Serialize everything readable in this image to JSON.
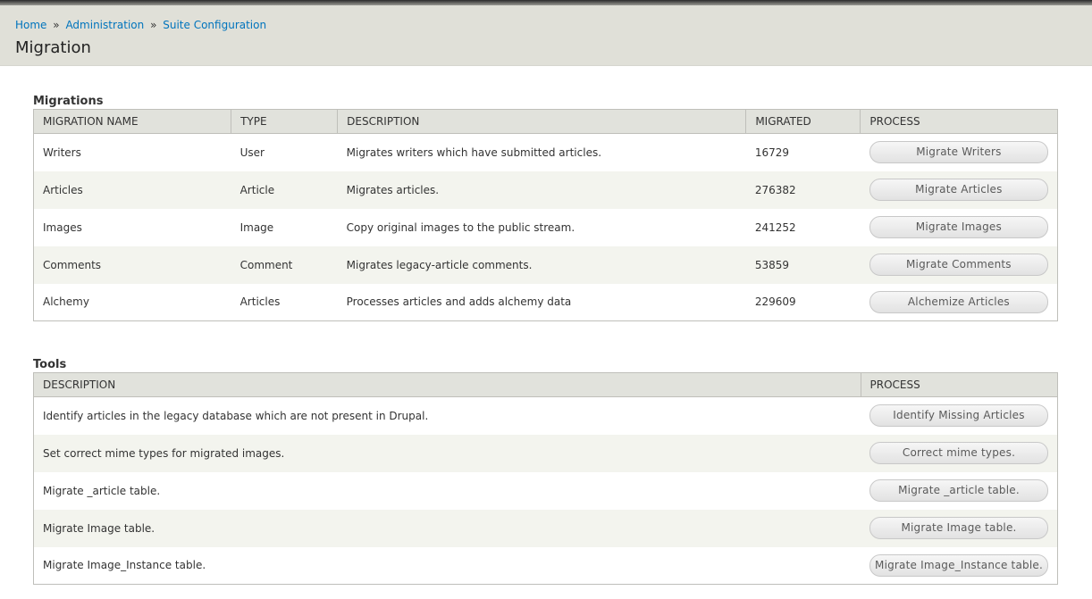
{
  "breadcrumb": {
    "items": [
      "Home",
      "Administration",
      "Suite Configuration"
    ],
    "separator": "»"
  },
  "page_title": "Migration",
  "migrations": {
    "title": "Migrations",
    "headers": [
      "MIGRATION NAME",
      "TYPE",
      "DESCRIPTION",
      "MIGRATED",
      "PROCESS"
    ],
    "rows": [
      {
        "name": "Writers",
        "type": "User",
        "description": "Migrates writers which have submitted articles.",
        "migrated": "16729",
        "button": "Migrate Writers"
      },
      {
        "name": "Articles",
        "type": "Article",
        "description": "Migrates articles.",
        "migrated": "276382",
        "button": "Migrate Articles"
      },
      {
        "name": "Images",
        "type": "Image",
        "description": "Copy original images to the public stream.",
        "migrated": "241252",
        "button": "Migrate Images"
      },
      {
        "name": "Comments",
        "type": "Comment",
        "description": "Migrates legacy-article comments.",
        "migrated": "53859",
        "button": "Migrate Comments"
      },
      {
        "name": "Alchemy",
        "type": "Articles",
        "description": "Processes articles and adds alchemy data",
        "migrated": "229609",
        "button": "Alchemize Articles"
      }
    ]
  },
  "tools": {
    "title": "Tools",
    "headers": [
      "DESCRIPTION",
      "PROCESS"
    ],
    "rows": [
      {
        "description": "Identify articles in the legacy database which are not present in Drupal.",
        "button": "Identify Missing Articles"
      },
      {
        "description": "Set correct mime types for migrated images.",
        "button": "Correct mime types."
      },
      {
        "description": "Migrate _article table.",
        "button": "Migrate _article table."
      },
      {
        "description": "Migrate Image table.",
        "button": "Migrate Image table."
      },
      {
        "description": "Migrate Image_Instance table.",
        "button": "Migrate Image_Instance table."
      }
    ]
  },
  "colors": {
    "link": "#0074bd",
    "header_bg": "#e0e0d8",
    "table_header_bg": "#e1e2dc",
    "row_alt_bg": "#f3f4ee"
  }
}
